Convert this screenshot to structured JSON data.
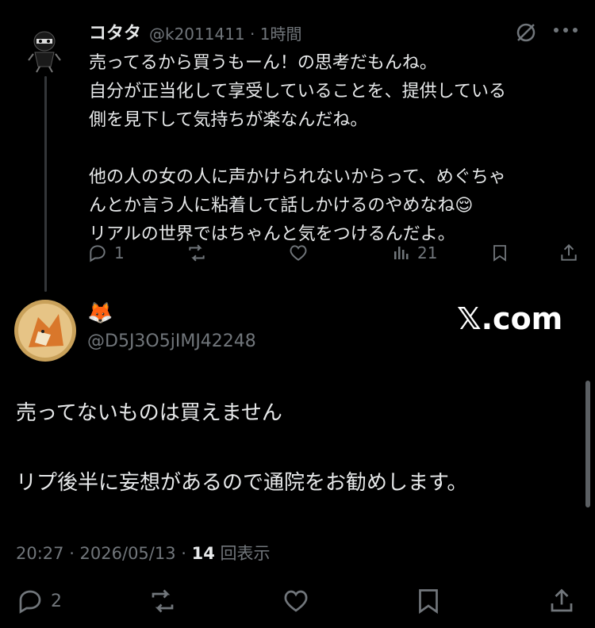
{
  "tweet1": {
    "name": "コタタ",
    "handle": "@k2011411 · 1時間",
    "body": "売ってるから買うもーん！の思考だもんね。\n自分が正当化して享受していることを、提供している\n側を見下して気持ちが楽なんだね。\n\n他の人の女の人に声かけられないからって、めぐちゃ\nんとか言う人に粘着して話しかけるのやめなね😌\nリアルの世界ではちゃんと気をつけるんだよ。",
    "reply_count": "1",
    "retweet_count": "",
    "like_count": "",
    "view_count": "21"
  },
  "tweet2": {
    "name": "🦊",
    "handle": "@D5J3O5jIMJ42248",
    "line1": "売ってないものは買えません",
    "line2": "リプ後半に妄想があるので通院をお勧めします。",
    "timestamp": "20:27 · 2026/05/13 · ",
    "views_number": "14",
    "views_label": " 回表示",
    "reply_count": "2"
  },
  "watermark": "𝕏.com",
  "colors": {
    "background": "#000000",
    "text": "#e7e9ea",
    "muted": "#71767b"
  }
}
